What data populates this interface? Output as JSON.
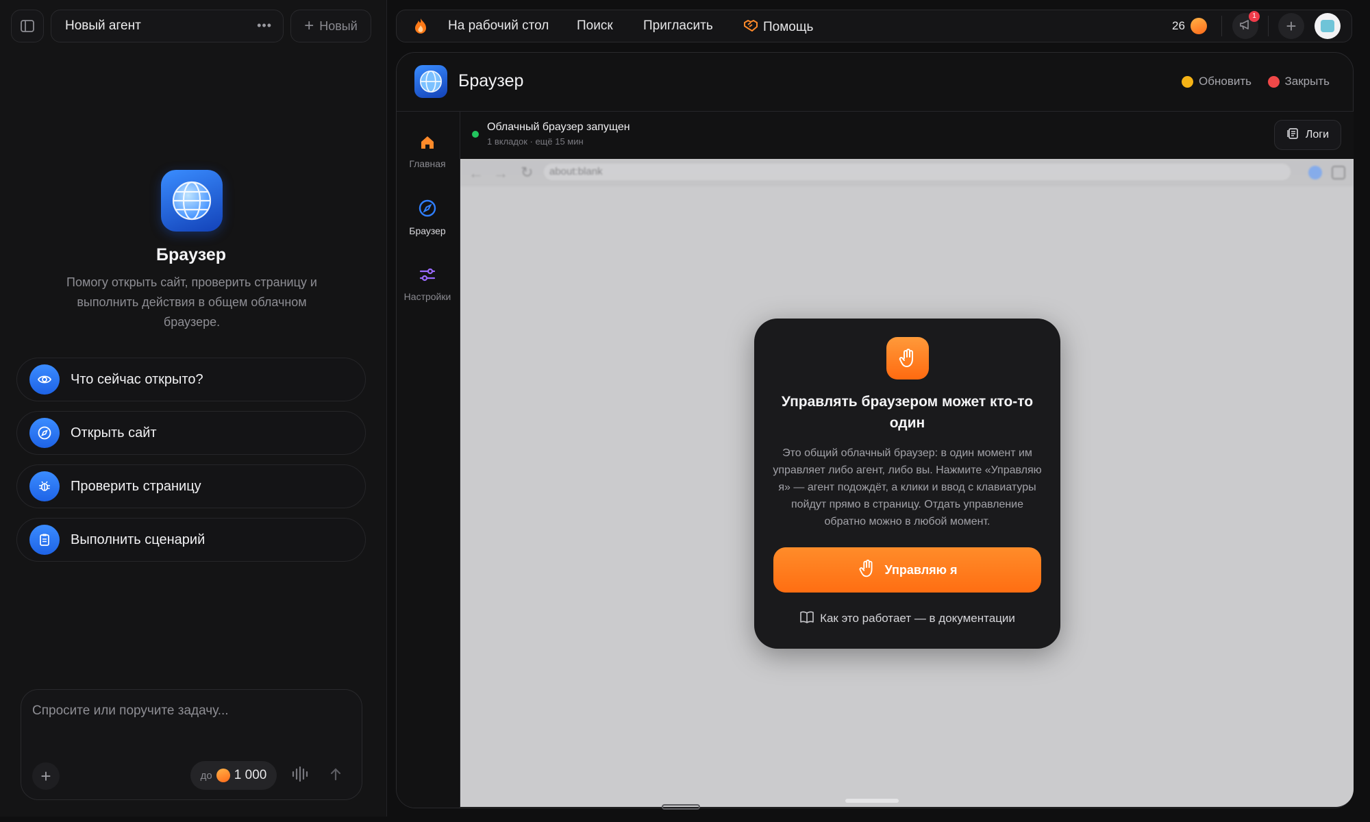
{
  "left": {
    "toggle_icon": "sidebar-toggle-icon",
    "agent_title": "Новый агент",
    "more_icon": "more-dots-icon",
    "new_button": "Новый",
    "hero_icon": "globe-icon",
    "hero_title": "Браузер",
    "hero_desc": "Помогу открыть сайт, проверить страницу и выполнить действия в общем облачном браузере.",
    "suggestions": [
      {
        "label": "Что сейчас открыто?",
        "icon": "eye-icon"
      },
      {
        "label": "Открыть сайт",
        "icon": "compass-icon"
      },
      {
        "label": "Проверить страницу",
        "icon": "bug-icon"
      },
      {
        "label": "Выполнить сценарий",
        "icon": "clipboard-icon"
      }
    ],
    "composer": {
      "placeholder": "Спросите или поручите задачу...",
      "limit_prefix": "до",
      "limit_value": "1 000"
    }
  },
  "topbar": {
    "desktop": "На рабочий стол",
    "search": "Поиск",
    "invite": "Пригласить",
    "help": "Помощь",
    "credits": "26",
    "notif_count": "1"
  },
  "panel": {
    "title": "Браузер",
    "refresh": "Обновить",
    "close": "Закрыть",
    "refresh_color": "#f5b316",
    "close_color": "#f04848",
    "status_title": "Облачный браузер запущен",
    "status_sub": "1 вкладок · ещё 15 мин",
    "logs": "Логи",
    "nav": [
      {
        "label": "Главная",
        "icon": "home-icon"
      },
      {
        "label": "Браузер",
        "icon": "compass-icon"
      },
      {
        "label": "Настройки",
        "icon": "sliders-icon"
      }
    ],
    "url": "about:blank"
  },
  "modal": {
    "title": "Управлять браузером может кто-то один",
    "body": "Это общий облачный браузер: в один момент им управляет либо агент, либо вы. Нажмите «Управляю я» — агент подождёт, а клики и ввод с клавиатуры пойдут прямо в страницу. Отдать управление обратно можно в любой момент.",
    "button": "Управляю я",
    "doc_link": "Как это работает — в документации",
    "accent": "#ff7a18"
  }
}
